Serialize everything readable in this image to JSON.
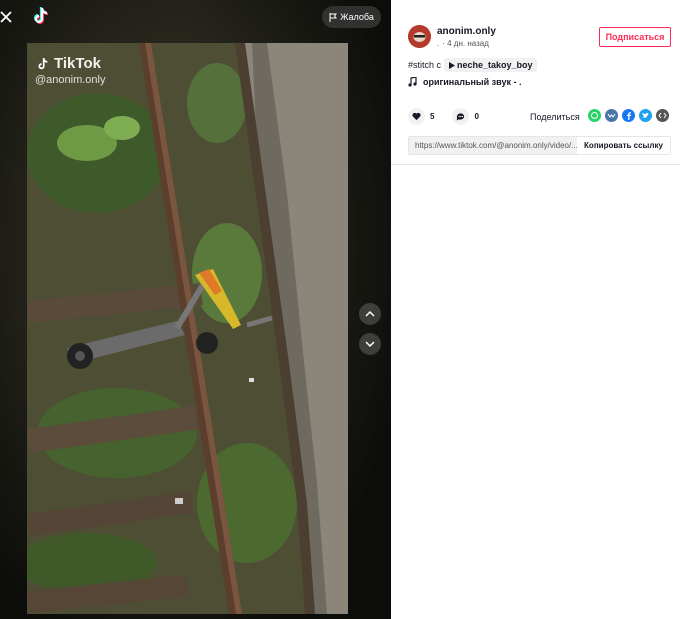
{
  "player": {
    "report_label": "Жалоба",
    "watermark_brand": "TikTok",
    "watermark_user": "@anonim.only"
  },
  "author": {
    "username": "anonim.only",
    "dot": ".",
    "time_ago": "· 4 дн. назад",
    "follow_label": "Подписаться"
  },
  "caption": {
    "hashtag_prefix": "#stitch с",
    "mention": "neche_takoy_boy"
  },
  "sound": {
    "title": "оригинальный звук - ."
  },
  "stats": {
    "likes": "5",
    "comments": "0"
  },
  "share": {
    "label": "Поделиться",
    "icons": [
      "whatsapp-icon",
      "vk-icon",
      "facebook-icon",
      "twitter-icon",
      "embed-icon"
    ]
  },
  "link": {
    "url": "https://www.tiktok.com/@anonim.only/video/...",
    "copy_label": "Копировать ссылку"
  },
  "colors": {
    "accent": "#fe2c55",
    "whatsapp": "#25d366",
    "vk": "#4a76a8",
    "facebook": "#1877f2",
    "twitter": "#1da1f2",
    "embed": "#555555"
  }
}
